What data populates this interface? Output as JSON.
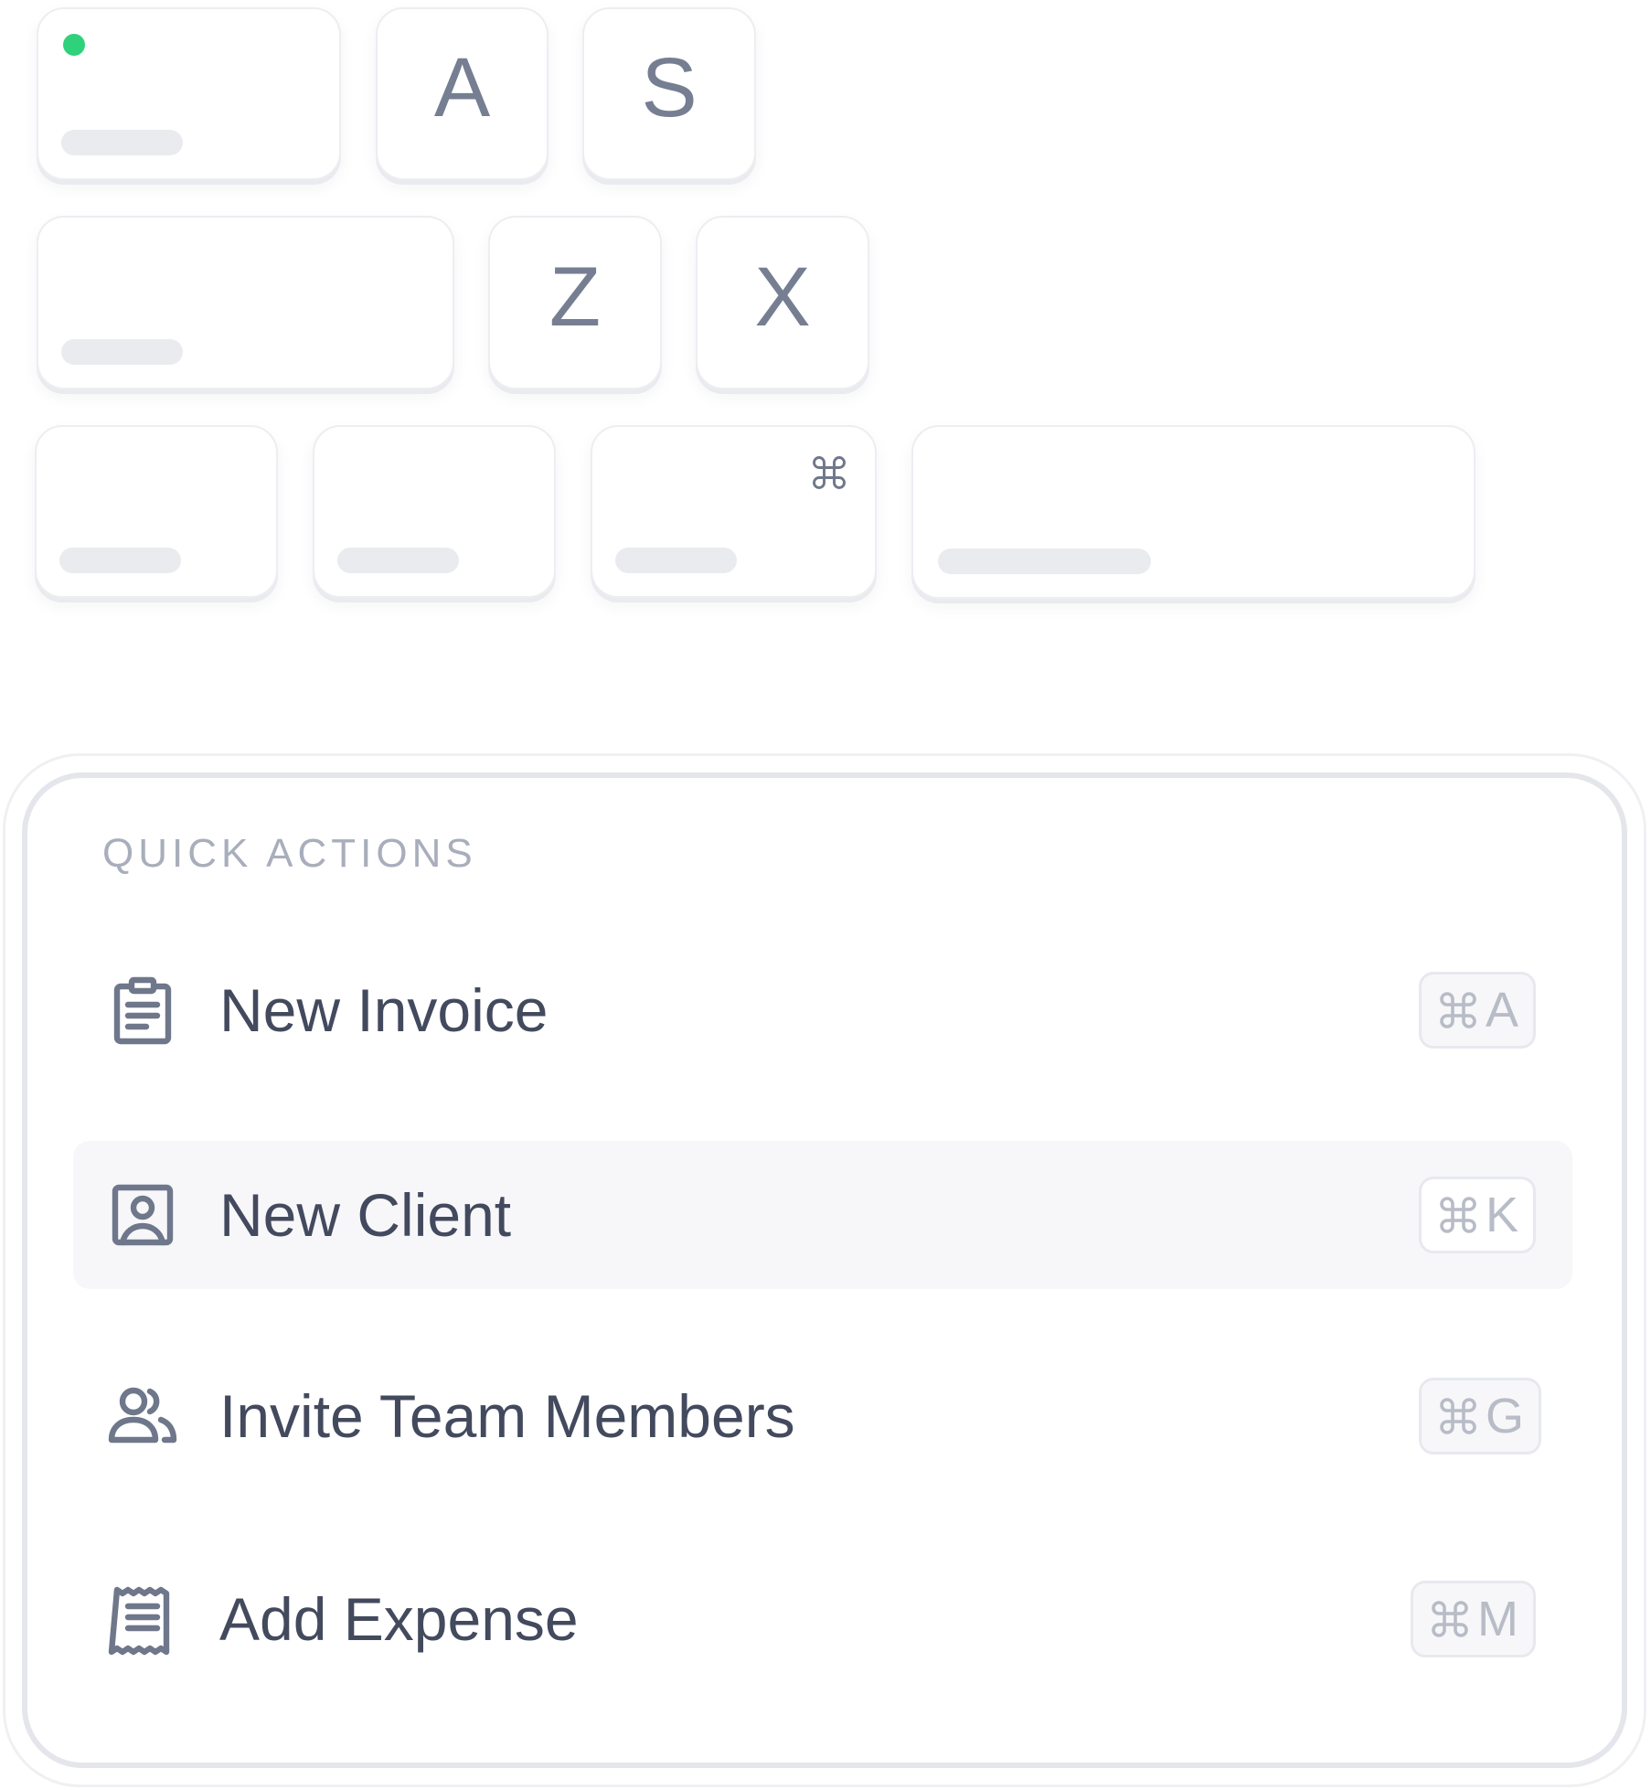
{
  "keyboard": {
    "row1": [
      {
        "id": "key-esc-indicator",
        "legend": "",
        "has_bar": true,
        "has_led": true
      },
      {
        "id": "key-a",
        "legend": "A",
        "has_bar": false
      },
      {
        "id": "key-s",
        "legend": "S",
        "has_bar": false
      }
    ],
    "row2": [
      {
        "id": "key-shift",
        "legend": "",
        "has_bar": true
      },
      {
        "id": "key-z",
        "legend": "Z",
        "has_bar": false
      },
      {
        "id": "key-x",
        "legend": "X",
        "has_bar": false
      }
    ],
    "row3": [
      {
        "id": "key-modifier-1",
        "legend": "",
        "has_bar": true
      },
      {
        "id": "key-modifier-2",
        "legend": "",
        "has_bar": true
      },
      {
        "id": "key-command",
        "legend": "",
        "has_bar": true,
        "icon": "command-icon"
      },
      {
        "id": "key-space",
        "legend": "",
        "has_bar": true
      }
    ],
    "led_color": "#2fd27a",
    "legend_color": "#767e92"
  },
  "quick_actions": {
    "title": "QUICK ACTIONS",
    "items": [
      {
        "label": "New Invoice",
        "icon": "clipboard-icon",
        "shortcut_modifier_icon": "command-icon",
        "shortcut_key": "A",
        "active": false
      },
      {
        "label": "New Client",
        "icon": "contact-card-icon",
        "shortcut_modifier_icon": "command-icon",
        "shortcut_key": "K",
        "active": true
      },
      {
        "label": "Invite Team Members",
        "icon": "users-icon",
        "shortcut_modifier_icon": "command-icon",
        "shortcut_key": "G",
        "active": false
      },
      {
        "label": "Add Expense",
        "icon": "receipt-icon",
        "shortcut_modifier_icon": "command-icon",
        "shortcut_key": "M",
        "active": false
      }
    ]
  },
  "colors": {
    "text_primary": "#434a5e",
    "text_muted": "#a8aebb",
    "icon": "#6f778b",
    "active_row_bg": "#f7f7fa",
    "panel_border": "#e4e6ec"
  }
}
